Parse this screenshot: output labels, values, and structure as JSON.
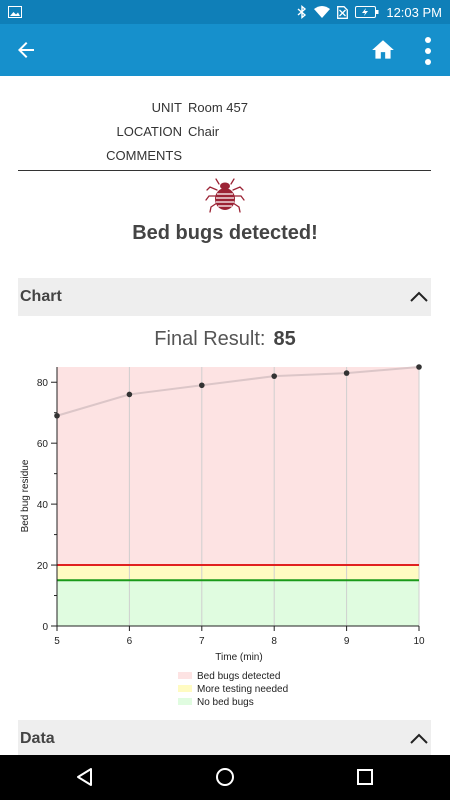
{
  "status_bar": {
    "time": "12:03 PM"
  },
  "app_bar": {
    "back_icon": "arrow-back-icon",
    "home_icon": "home-icon",
    "menu_icon": "more-vert-icon"
  },
  "info": {
    "unit_label": "UNIT",
    "unit_value": "Room 457",
    "location_label": "LOCATION",
    "location_value": "Chair",
    "comments_label": "COMMENTS",
    "comments_value": ""
  },
  "result": {
    "icon": "bed-bug-icon",
    "heading": "Bed bugs detected!"
  },
  "sections": {
    "chart_title": "Chart",
    "data_title": "Data"
  },
  "final_result": {
    "label": "Final Result:",
    "value": "85"
  },
  "colors": {
    "accent": "#1690cc",
    "detected_zone": "#fde3e3",
    "more_testing_zone": "#fffbc2",
    "no_bugs_zone": "#e0fce0",
    "threshold_red": "#e02020",
    "threshold_green": "#1a9a1a",
    "series_line": "#dcc6c8",
    "marker": "#333333"
  },
  "chart_data": {
    "type": "line",
    "x": [
      5,
      6,
      7,
      8,
      9,
      10
    ],
    "y": [
      69,
      76,
      79,
      82,
      83,
      85
    ],
    "xlabel": "Time (min)",
    "ylabel": "Bed bug residue",
    "xlim": [
      5,
      10
    ],
    "ylim": [
      0,
      85
    ],
    "xticks": [
      "5",
      "6",
      "7",
      "8",
      "9",
      "10"
    ],
    "yticks": [
      "0",
      "20",
      "40",
      "60",
      "80"
    ],
    "ytick_values": [
      0,
      20,
      40,
      60,
      80
    ],
    "thresholds": {
      "detected_above": 20,
      "no_bugs_below": 15
    },
    "zones": [
      {
        "label": "Bed bugs detected",
        "from": 20,
        "to": 85,
        "color": "#fde3e3"
      },
      {
        "label": "More testing needed",
        "from": 15,
        "to": 20,
        "color": "#fffbc2"
      },
      {
        "label": "No bed bugs",
        "from": 0,
        "to": 15,
        "color": "#e0fce0"
      }
    ],
    "legend": [
      "Bed bugs detected",
      "More testing needed",
      "No bed bugs"
    ],
    "legend_position": "bottom-center",
    "grid": "vertical"
  }
}
